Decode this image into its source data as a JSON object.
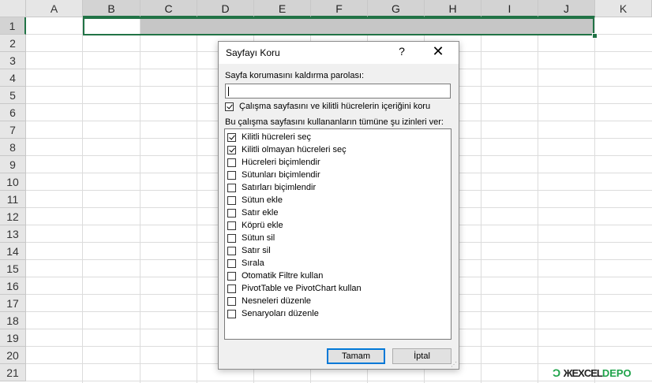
{
  "sheet": {
    "columns": [
      "A",
      "B",
      "C",
      "D",
      "E",
      "F",
      "G",
      "H",
      "I",
      "J",
      "K"
    ],
    "rows": [
      "1",
      "2",
      "3",
      "4",
      "5",
      "6",
      "7",
      "8",
      "9",
      "10",
      "11",
      "12",
      "13",
      "14",
      "15",
      "16",
      "17",
      "18",
      "19",
      "20",
      "21"
    ]
  },
  "dialog": {
    "title": "Sayfayı Koru",
    "help": "?",
    "close": "✕",
    "password_label": "Sayfa korumasını kaldırma parolası:",
    "password_value": "",
    "protect_label": "Çalışma sayfasını ve kilitli hücrelerin içeriğini koru",
    "protect_checked": true,
    "allow_label": "Bu çalışma sayfasını kullananların tümüne şu izinleri ver:",
    "permissions": [
      {
        "label": "Kilitli hücreleri seç",
        "checked": true
      },
      {
        "label": "Kilitli olmayan hücreleri seç",
        "checked": true
      },
      {
        "label": "Hücreleri biçimlendir",
        "checked": false
      },
      {
        "label": "Sütunları biçimlendir",
        "checked": false
      },
      {
        "label": "Satırları biçimlendir",
        "checked": false
      },
      {
        "label": "Sütun ekle",
        "checked": false
      },
      {
        "label": "Satır ekle",
        "checked": false
      },
      {
        "label": "Köprü ekle",
        "checked": false
      },
      {
        "label": "Sütun sil",
        "checked": false
      },
      {
        "label": "Satır sil",
        "checked": false
      },
      {
        "label": "Sırala",
        "checked": false
      },
      {
        "label": "Otomatik Filtre kullan",
        "checked": false
      },
      {
        "label": "PivotTable ve PivotChart kullan",
        "checked": false
      },
      {
        "label": "Nesneleri düzenle",
        "checked": false
      },
      {
        "label": "Senaryoları düzenle",
        "checked": false
      }
    ],
    "ok_label": "Tamam",
    "cancel_label": "İptal"
  },
  "watermark": {
    "prefix": "Ɔ",
    "part1": "ЖEXCEL",
    "part2": "DEPO"
  }
}
